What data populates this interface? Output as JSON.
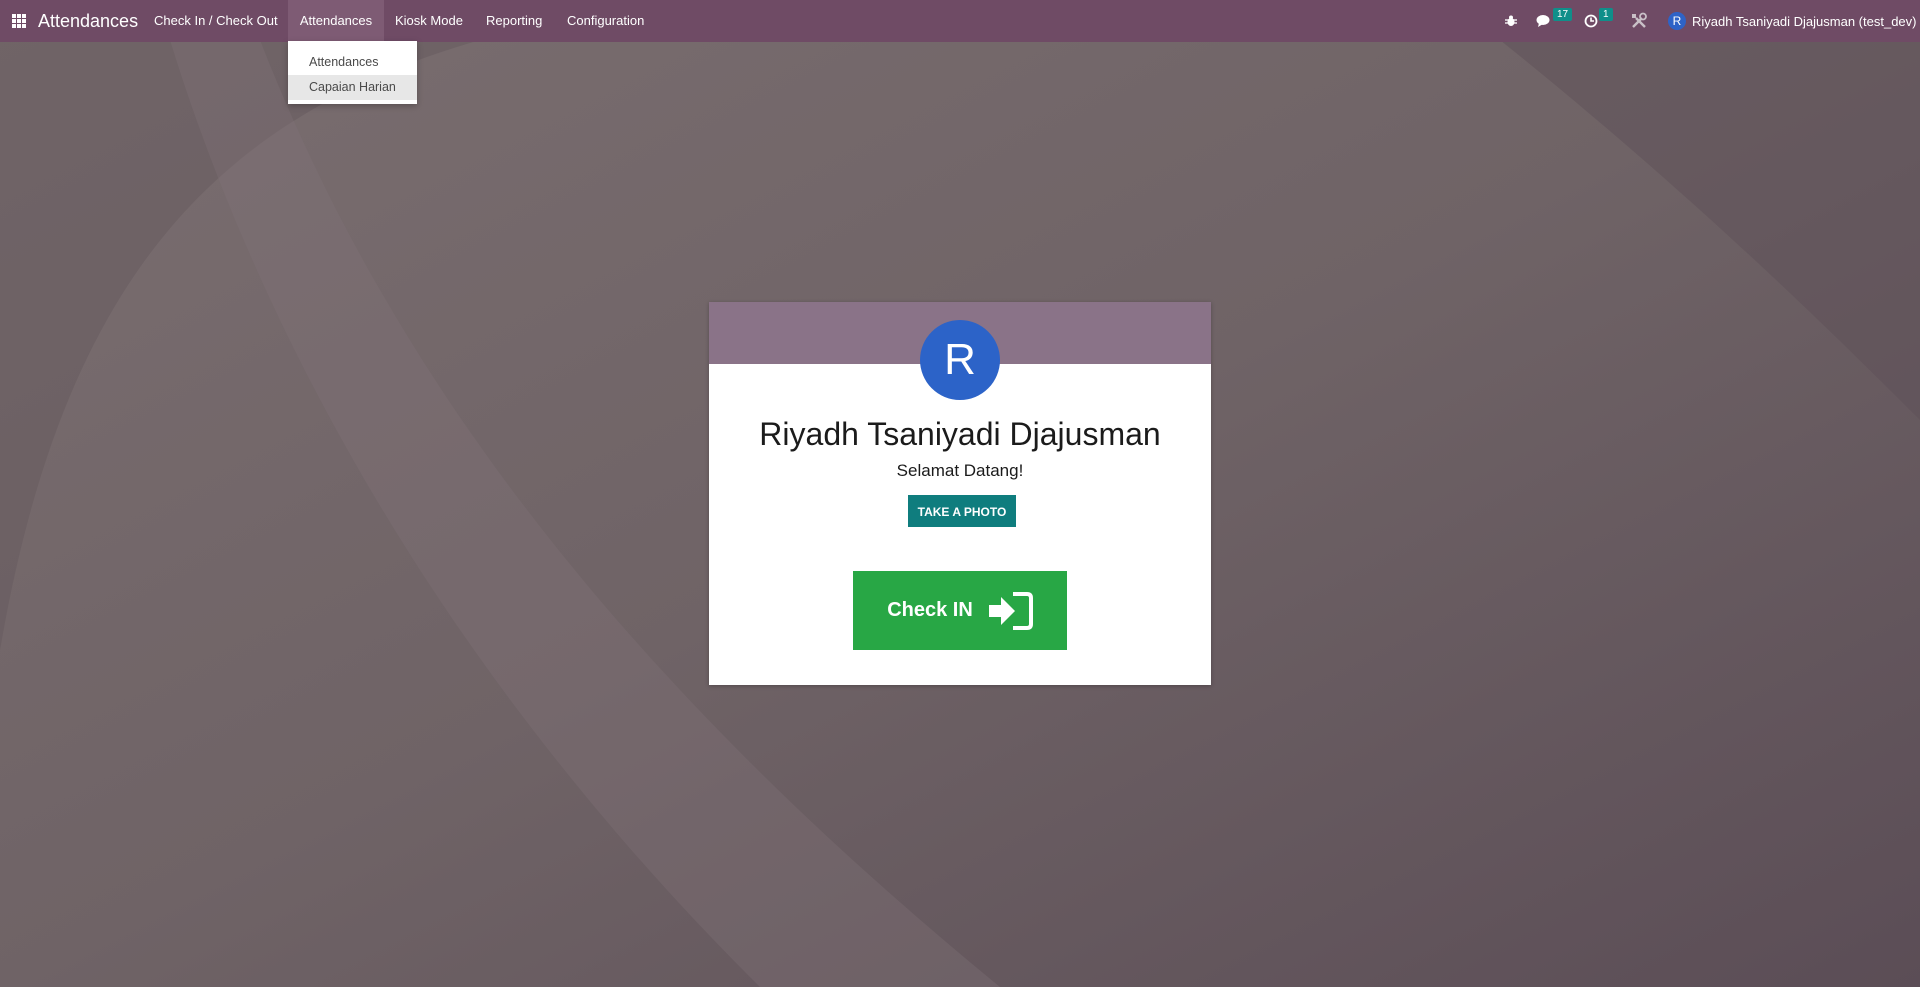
{
  "navbar": {
    "app_title": "Attendances",
    "menu": [
      {
        "label": "Check In / Check Out"
      },
      {
        "label": "Attendances"
      },
      {
        "label": "Kiosk Mode"
      },
      {
        "label": "Reporting"
      },
      {
        "label": "Configuration"
      }
    ],
    "messages_count": "17",
    "activities_count": "1",
    "user_initial": "R",
    "user_label": "Riyadh Tsaniyadi Djajusman (test_dev)"
  },
  "dropdown": {
    "items": [
      {
        "label": "Attendances"
      },
      {
        "label": "Capaian Harian"
      }
    ]
  },
  "card": {
    "avatar_initial": "R",
    "employee_name": "Riyadh Tsaniyadi Djajusman",
    "greeting": "Selamat Datang!",
    "photo_button": "TAKE A PHOTO",
    "checkin_button": "Check IN"
  },
  "colors": {
    "navbar": "#6f4b65",
    "card_header": "#8a7388",
    "avatar": "#2c63c8",
    "photo_button": "#0f7d7e",
    "checkin_button": "#28a745",
    "badge": "#0f8f8a"
  }
}
